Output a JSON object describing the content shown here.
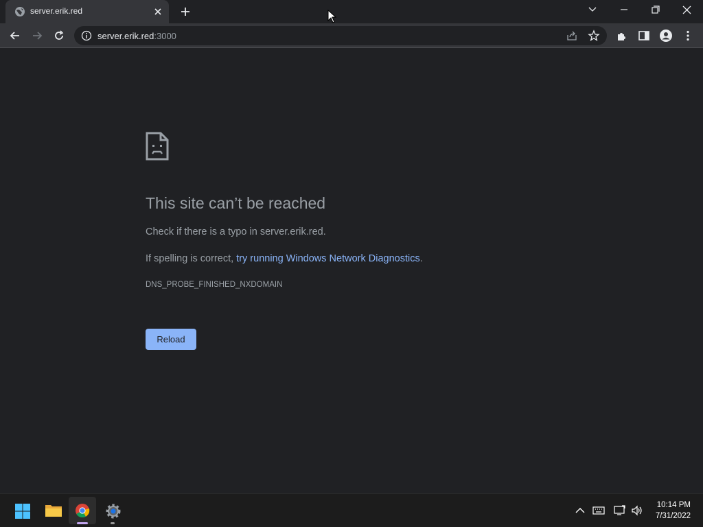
{
  "tab": {
    "title": "server.erik.red"
  },
  "omnibox": {
    "url_host": "server.erik.red",
    "url_port": ":3000"
  },
  "error_page": {
    "heading": "This site can’t be reached",
    "line1": "Check if there is a typo in server.erik.red.",
    "line2_prefix": "If spelling is correct, ",
    "line2_link": "try running Windows Network Diagnostics",
    "line2_suffix": ".",
    "error_code": "DNS_PROBE_FINISHED_NXDOMAIN",
    "reload_label": "Reload"
  },
  "taskbar": {
    "time": "10:14 PM",
    "date": "7/31/2022"
  },
  "colors": {
    "accent": "#8ab4f8",
    "background": "#202124",
    "toolbar": "#35363a"
  }
}
